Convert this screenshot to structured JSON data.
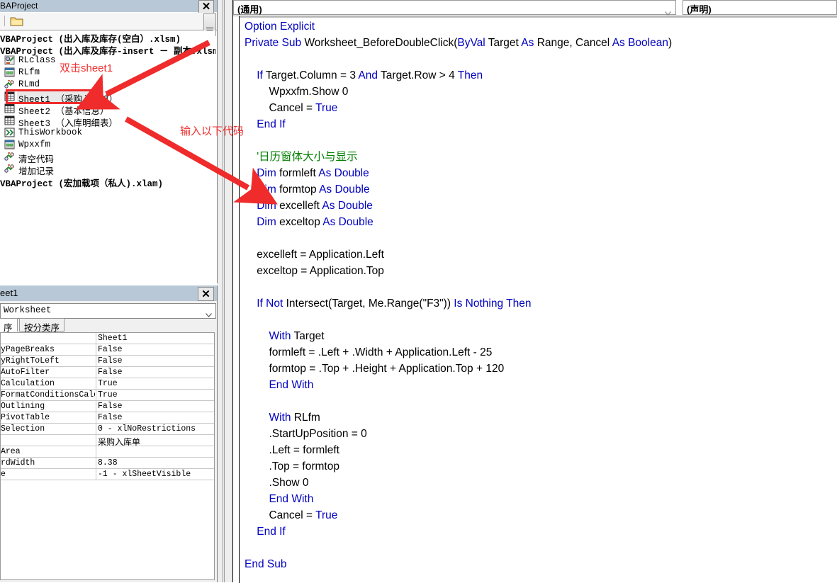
{
  "project_explorer": {
    "title": "BAProject",
    "close_label": "✕",
    "toolbar": {
      "folder_icon": "folder-icon"
    },
    "tree": [
      {
        "type": "project",
        "label": "VBAProject (出入库及库存(空白）.xlsm)"
      },
      {
        "type": "project",
        "label": "VBAProject (出入库及库存-insert － 副本.xlsm)"
      },
      {
        "type": "classmodule",
        "label": "RLclass",
        "icon": "class-module-icon"
      },
      {
        "type": "userform",
        "label": "RLfm",
        "icon": "userform-icon"
      },
      {
        "type": "module",
        "label": "RLmd",
        "icon": "module-icon"
      },
      {
        "type": "sheet",
        "label": "Sheet1 （采购入库单）",
        "icon": "worksheet-icon",
        "selected": true,
        "highlighted": true
      },
      {
        "type": "sheet",
        "label": "Sheet2 （基本信息）",
        "icon": "worksheet-icon"
      },
      {
        "type": "sheet",
        "label": "Sheet3 （入库明细表）",
        "icon": "worksheet-icon"
      },
      {
        "type": "workbook",
        "label": "ThisWorkbook",
        "icon": "workbook-icon"
      },
      {
        "type": "userform",
        "label": "Wpxxfm",
        "icon": "userform-icon"
      },
      {
        "type": "module",
        "label": "清空代码",
        "icon": "module-icon"
      },
      {
        "type": "module",
        "label": "增加记录",
        "icon": "module-icon"
      },
      {
        "type": "project",
        "label": "VBAProject (宏加载项（私人).xlam)"
      }
    ]
  },
  "properties_window": {
    "title": "eet1",
    "close_label": "✕",
    "object_combo": {
      "value": "Worksheet",
      "icon": "chevron-down-icon"
    },
    "tabs": [
      {
        "label": "序",
        "selected": true
      },
      {
        "label": "按分类序",
        "selected": false
      }
    ],
    "rows": [
      {
        "name": "",
        "value": "Sheet1",
        "cjk": false
      },
      {
        "name": "yPageBreaks",
        "value": "False",
        "cjk": false
      },
      {
        "name": "yRightToLeft",
        "value": "False",
        "cjk": false
      },
      {
        "name": "AutoFilter",
        "value": "False",
        "cjk": false
      },
      {
        "name": "Calculation",
        "value": "True",
        "cjk": false
      },
      {
        "name": "FormatConditionsCalcul",
        "value": "True",
        "cjk": false
      },
      {
        "name": "Outlining",
        "value": "False",
        "cjk": false
      },
      {
        "name": "PivotTable",
        "value": "False",
        "cjk": false
      },
      {
        "name": "Selection",
        "value": "0 - xlNoRestrictions",
        "cjk": false
      },
      {
        "name": "",
        "value": "采购入库单",
        "cjk": true
      },
      {
        "name": "Area",
        "value": "",
        "cjk": false
      },
      {
        "name": "rdWidth",
        "value": "8.38",
        "cjk": false
      },
      {
        "name": "e",
        "value": "-1 - xlSheetVisible",
        "cjk": false
      }
    ]
  },
  "code_window": {
    "object_combo": {
      "value": "(通用)",
      "icon": "chevron-down-icon"
    },
    "proc_combo": {
      "value": "(声明)"
    },
    "lines": [
      [
        {
          "t": "Option Explicit",
          "c": "kw"
        }
      ],
      [
        {
          "t": "Private Sub ",
          "c": "kw"
        },
        {
          "t": "Worksheet_BeforeDoubleClick(",
          "c": "pl"
        },
        {
          "t": "ByVal ",
          "c": "kw"
        },
        {
          "t": "Target ",
          "c": "pl"
        },
        {
          "t": "As ",
          "c": "kw"
        },
        {
          "t": "Range, ",
          "c": "pl"
        },
        {
          "t": "Cancel ",
          "c": "pl"
        },
        {
          "t": "As Boolean",
          "c": "kw"
        },
        {
          "t": ")",
          "c": "pl"
        }
      ],
      [],
      [
        {
          "t": "    ",
          "c": "pl"
        },
        {
          "t": "If ",
          "c": "kw"
        },
        {
          "t": "Target.Column = 3 ",
          "c": "pl"
        },
        {
          "t": "And ",
          "c": "kw"
        },
        {
          "t": "Target.Row > 4 ",
          "c": "pl"
        },
        {
          "t": "Then",
          "c": "kw"
        }
      ],
      [
        {
          "t": "        Wpxxfm.Show 0",
          "c": "pl"
        }
      ],
      [
        {
          "t": "        Cancel = ",
          "c": "pl"
        },
        {
          "t": "True",
          "c": "kw"
        }
      ],
      [
        {
          "t": "    ",
          "c": "pl"
        },
        {
          "t": "End If",
          "c": "kw"
        }
      ],
      [],
      [
        {
          "t": "    '日历窗体大小与显示",
          "c": "cm"
        }
      ],
      [
        {
          "t": "    ",
          "c": "pl"
        },
        {
          "t": "Dim ",
          "c": "kw"
        },
        {
          "t": "formleft ",
          "c": "pl"
        },
        {
          "t": "As Double",
          "c": "kw"
        }
      ],
      [
        {
          "t": "    ",
          "c": "pl"
        },
        {
          "t": "Dim ",
          "c": "kw"
        },
        {
          "t": "formtop ",
          "c": "pl"
        },
        {
          "t": "As Double",
          "c": "kw"
        }
      ],
      [
        {
          "t": "    ",
          "c": "pl"
        },
        {
          "t": "Dim ",
          "c": "kw"
        },
        {
          "t": "excelleft ",
          "c": "pl"
        },
        {
          "t": "As Double",
          "c": "kw"
        }
      ],
      [
        {
          "t": "    ",
          "c": "pl"
        },
        {
          "t": "Dim ",
          "c": "kw"
        },
        {
          "t": "exceltop ",
          "c": "pl"
        },
        {
          "t": "As Double",
          "c": "kw"
        }
      ],
      [],
      [
        {
          "t": "    excelleft = Application.Left",
          "c": "pl"
        }
      ],
      [
        {
          "t": "    exceltop = Application.Top",
          "c": "pl"
        }
      ],
      [],
      [
        {
          "t": "    ",
          "c": "pl"
        },
        {
          "t": "If Not ",
          "c": "kw"
        },
        {
          "t": "Intersect(Target, Me.Range(\"F3\")) ",
          "c": "pl"
        },
        {
          "t": "Is Nothing Then",
          "c": "kw"
        }
      ],
      [],
      [
        {
          "t": "        ",
          "c": "pl"
        },
        {
          "t": "With ",
          "c": "kw"
        },
        {
          "t": "Target",
          "c": "pl"
        }
      ],
      [
        {
          "t": "        formleft = .Left + .Width + Application.Left - 25",
          "c": "pl"
        }
      ],
      [
        {
          "t": "        formtop = .Top + .Height + Application.Top + 120",
          "c": "pl"
        }
      ],
      [
        {
          "t": "        ",
          "c": "pl"
        },
        {
          "t": "End With",
          "c": "kw"
        }
      ],
      [],
      [
        {
          "t": "        ",
          "c": "pl"
        },
        {
          "t": "With ",
          "c": "kw"
        },
        {
          "t": "RLfm",
          "c": "pl"
        }
      ],
      [
        {
          "t": "        .StartUpPosition = 0",
          "c": "pl"
        }
      ],
      [
        {
          "t": "        .Left = formleft",
          "c": "pl"
        }
      ],
      [
        {
          "t": "        .Top = formtop",
          "c": "pl"
        }
      ],
      [
        {
          "t": "        .Show 0",
          "c": "pl"
        }
      ],
      [
        {
          "t": "        ",
          "c": "pl"
        },
        {
          "t": "End With",
          "c": "kw"
        }
      ],
      [
        {
          "t": "        Cancel = ",
          "c": "pl"
        },
        {
          "t": "True",
          "c": "kw"
        }
      ],
      [
        {
          "t": "    ",
          "c": "pl"
        },
        {
          "t": "End If",
          "c": "kw"
        }
      ],
      [],
      [
        {
          "t": "End Sub",
          "c": "kw"
        }
      ]
    ]
  },
  "annotations": {
    "color": "#f03030",
    "note1": "双击sheet1",
    "note2": "输入以下代码",
    "highlight_target": "Sheet1 （采购入库单）"
  }
}
